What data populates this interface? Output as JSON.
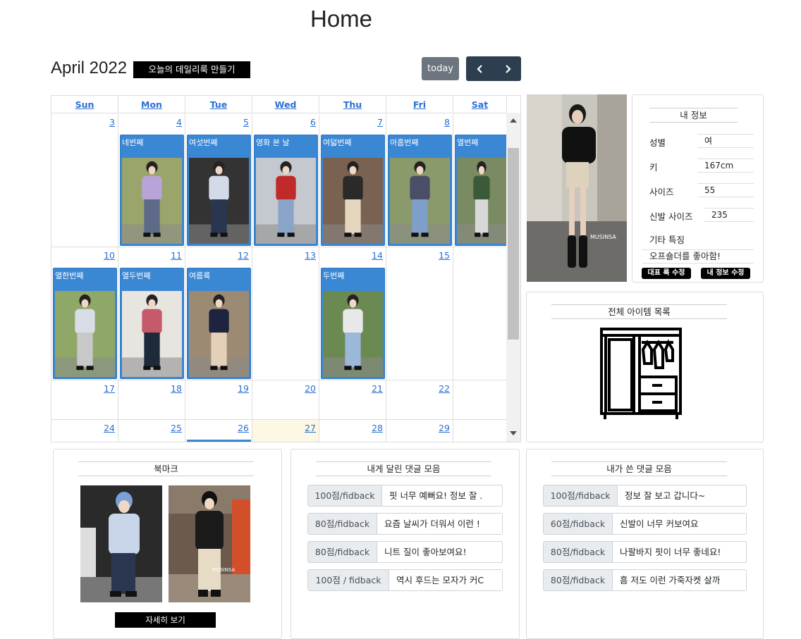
{
  "header": {
    "title": "Home"
  },
  "toolbar": {
    "month_title": "April 2022",
    "daily_look_button": "오늘의 데일리룩 만들기",
    "today_button": "today",
    "prev_icon": "chevron-left-icon",
    "next_icon": "chevron-right-icon"
  },
  "calendar": {
    "weekdays": [
      "Sun",
      "Mon",
      "Tue",
      "Wed",
      "Thu",
      "Fri",
      "Sat"
    ],
    "weeks": [
      [
        "3",
        "4",
        "5",
        "6",
        "7",
        "8",
        ""
      ],
      [
        "10",
        "11",
        "12",
        "13",
        "14",
        "15",
        ""
      ],
      [
        "17",
        "18",
        "19",
        "20",
        "21",
        "22",
        ""
      ],
      [
        "24",
        "25",
        "26",
        "27",
        "28",
        "29",
        ""
      ]
    ],
    "events": [
      {
        "day": "4",
        "title": "네번째"
      },
      {
        "day": "5",
        "title": "여섯번째"
      },
      {
        "day": "6",
        "title": "영화 본 날"
      },
      {
        "day": "7",
        "title": "여덟번째"
      },
      {
        "day": "8",
        "title": "아홉번째"
      },
      {
        "day": "9",
        "title": "열번째"
      },
      {
        "day": "10",
        "title": "열한번째"
      },
      {
        "day": "11",
        "title": "열두번째"
      },
      {
        "day": "12",
        "title": "여름룩"
      },
      {
        "day": "14",
        "title": "두번째"
      }
    ],
    "today": "27",
    "colors": {
      "event": "#3a87d4",
      "today": "#fcf8e3",
      "link": "#2a6fd6"
    }
  },
  "profile": {
    "title": "내 정보",
    "fields": [
      {
        "label": "성별",
        "value": "여"
      },
      {
        "label": "키",
        "value": "167cm"
      },
      {
        "label": "사이즈",
        "value": "55"
      },
      {
        "label": "신발 사이즈",
        "value": "235"
      }
    ],
    "extra_label": "기타 특징",
    "extra_value": "오프숄더를 좋아함!",
    "rep_look_button": "대표 룩 수정",
    "edit_info_button": "내 정보 수정",
    "photo_watermark": "MUSINSA"
  },
  "items": {
    "title": "전체 아이템 목록",
    "icon": "wardrobe-icon"
  },
  "bookmark": {
    "title": "북마크",
    "detail_button": "자세히 보기",
    "watermark": "MUSINSA"
  },
  "received_comments": {
    "title": "내게 달린 댓글 모음",
    "rows": [
      {
        "score": "100점/fidback",
        "text": "핏 너무 예뻐요! 정보 잘 ."
      },
      {
        "score": "80점/fidback",
        "text": "요즘 날씨가 더워서 이런 !"
      },
      {
        "score": "80점/fidback",
        "text": "니트 질이 좋아보여요!"
      },
      {
        "score": "100점 / fidback",
        "text": "역시 후드는 모자가 커C"
      }
    ]
  },
  "written_comments": {
    "title": "내가 쓴 댓글 모음",
    "rows": [
      {
        "score": "100점/fidback",
        "text": "정보 잘 보고 갑니다~"
      },
      {
        "score": "60점/fidback",
        "text": "신발이 너무 커보여요"
      },
      {
        "score": "80점/fidback",
        "text": "나팔바지 핏이 너무 좋네요!"
      },
      {
        "score": "80점/fidback",
        "text": "흠 저도 이런 가죽자켓 살까"
      }
    ]
  }
}
